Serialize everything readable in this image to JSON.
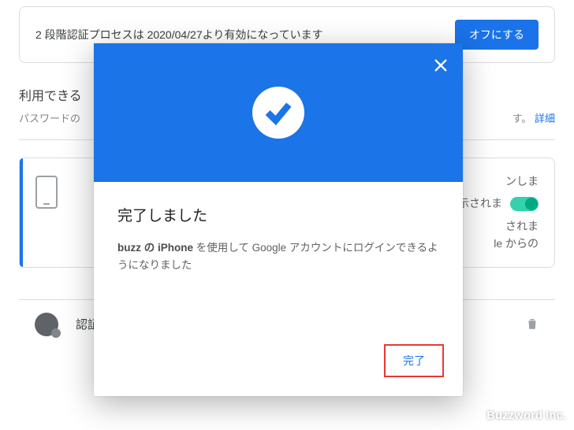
{
  "status_card": {
    "text": "2 段階認証プロセスは 2020/04/27より有効になっています",
    "off_button": "オフにする"
  },
  "section": {
    "title_fragment": "利用できる",
    "desc_prefix": "パスワードの",
    "desc_suffix": "す。",
    "link": "詳細"
  },
  "method1": {
    "line1_suffix": "ンしま",
    "line2_suffix": "示されま",
    "line3a": "されま",
    "line3b": "le からの"
  },
  "method2": {
    "title": "認証システム アプリ"
  },
  "modal": {
    "title": "完了しました",
    "desc_bold": "buzz の iPhone",
    "desc_rest": " を使用して Google アカウントにログインできるようになりました",
    "done": "完了"
  },
  "watermark": "Buzzword Inc."
}
